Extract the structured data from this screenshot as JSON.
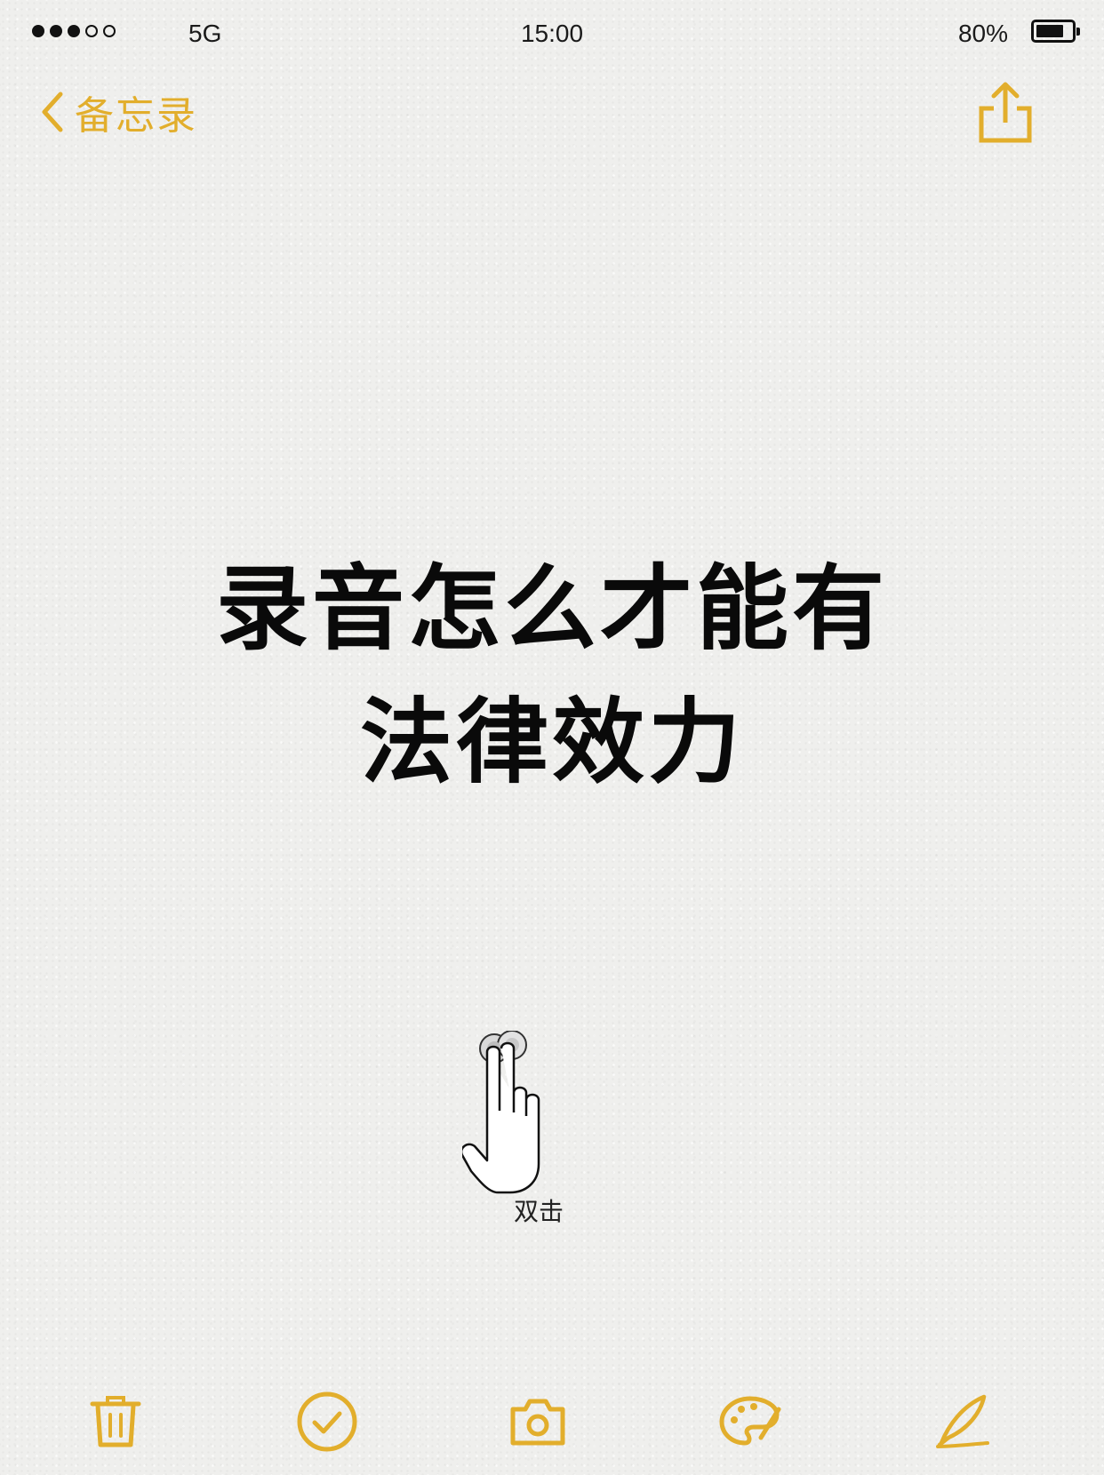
{
  "status_bar": {
    "signal": {
      "filled": 3,
      "total": 5
    },
    "carrier": "5G",
    "time": "15:00",
    "battery_percent_label": "80%",
    "battery_level": 0.8
  },
  "nav": {
    "back_label": "备忘录",
    "back_icon": "chevron-left-icon",
    "share_icon": "share-icon"
  },
  "note": {
    "title_lines": [
      "录音怎么才能有",
      "法律效力"
    ]
  },
  "gesture_hint": {
    "icon": "double-tap-hand-icon",
    "label": "双击"
  },
  "toolbar": {
    "items": [
      "trash-icon",
      "checklist-icon",
      "camera-icon",
      "palette-icon",
      "compose-pen-icon"
    ]
  },
  "colors": {
    "accent": "#e2ae2c",
    "text": "#0a0a0a",
    "background": "#efefed"
  }
}
